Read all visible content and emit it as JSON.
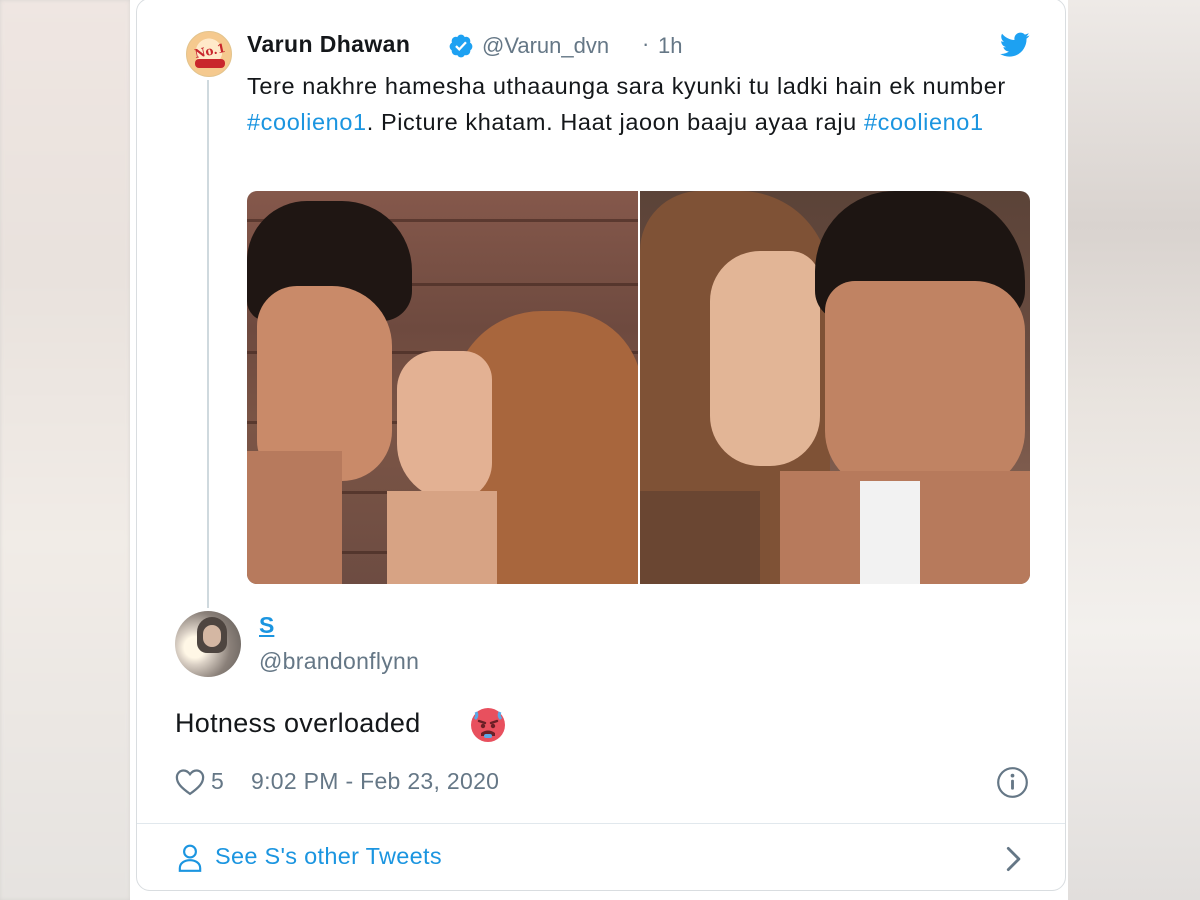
{
  "tweet": {
    "author_name": "Varun Dhawan",
    "author_handle": "@Varun_dvn",
    "separator": "·",
    "time_ago": "1h",
    "text_parts": [
      "Tere nakhre hamesha uthaaunga sara kyunki tu ladki hain ek number ",
      "#coolieno1",
      ". Picture khatam. Haat jaoon baaju ayaa raju ",
      "#coolieno1"
    ],
    "verified_icon": "verified-badge-icon",
    "brand_icon": "twitter-bird-icon"
  },
  "reply": {
    "author_name": "S",
    "author_handle": "@brandonflynn",
    "text": "Hotness overloaded",
    "emoji": "hot-face-emoji",
    "like_count": "5",
    "timestamp": "9:02 PM - Feb 23, 2020"
  },
  "footer": {
    "see_more_label": "See S's other Tweets"
  },
  "colors": {
    "accent": "#1b95e0",
    "text": "#14171a",
    "muted": "#657786",
    "border": "#e1e8ed"
  }
}
